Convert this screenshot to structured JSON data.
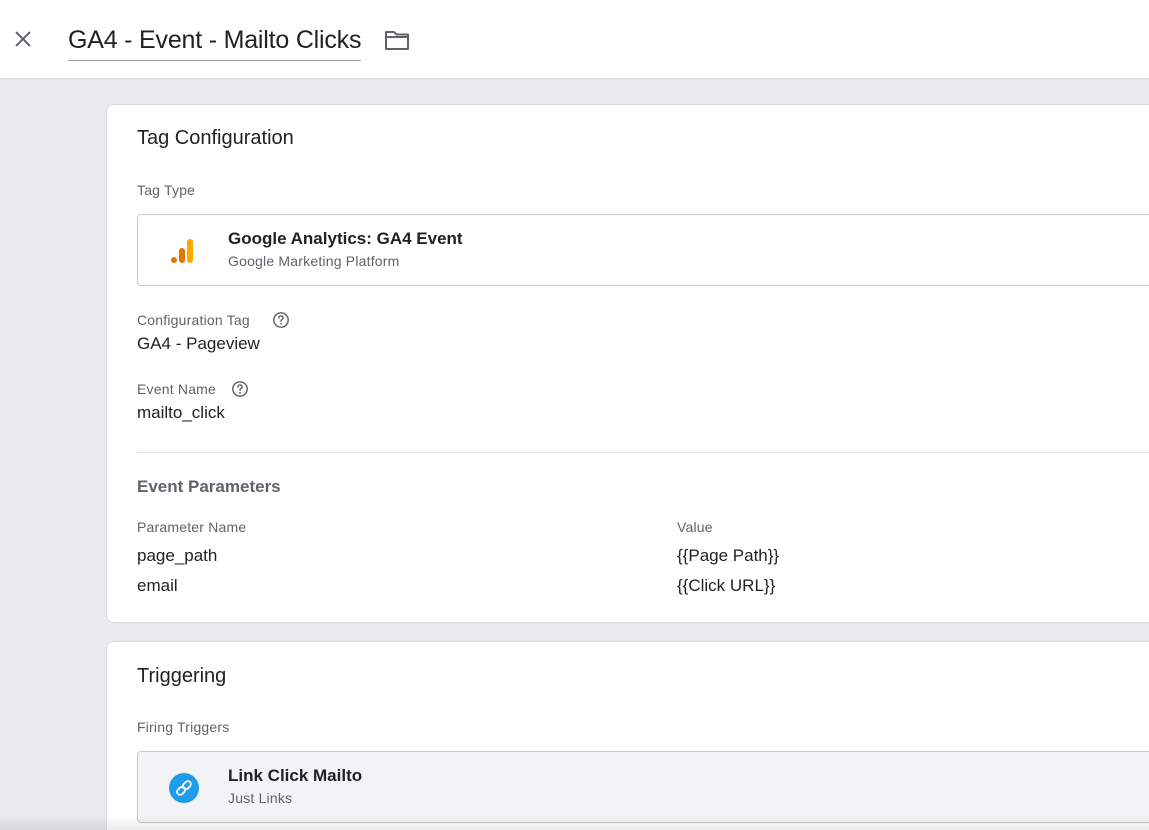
{
  "header": {
    "title": "GA4 - Event - Mailto Clicks",
    "close_icon": "close-icon",
    "folder_icon": "folder-icon"
  },
  "tag_configuration": {
    "title": "Tag Configuration",
    "tag_type_label": "Tag Type",
    "tag_type": {
      "name": "Google Analytics: GA4 Event",
      "vendor": "Google Marketing Platform",
      "icon": "google-analytics-icon"
    },
    "configuration_tag": {
      "label": "Configuration Tag",
      "value": "GA4 - Pageview"
    },
    "event_name": {
      "label": "Event Name",
      "value": "mailto_click"
    },
    "event_parameters": {
      "title": "Event Parameters",
      "columns": [
        "Parameter Name",
        "Value"
      ],
      "rows": [
        [
          "page_path",
          "{{Page Path}}"
        ],
        [
          "email",
          "{{Click URL}}"
        ]
      ]
    }
  },
  "triggering": {
    "title": "Triggering",
    "firing_label": "Firing Triggers",
    "trigger": {
      "name": "Link Click Mailto",
      "type": "Just Links",
      "icon": "link-icon"
    }
  },
  "colors": {
    "analytics_dark": "#e37400",
    "analytics_light": "#f9ab00",
    "link_blue": "#1e9bea",
    "background": "#e8eaed"
  }
}
